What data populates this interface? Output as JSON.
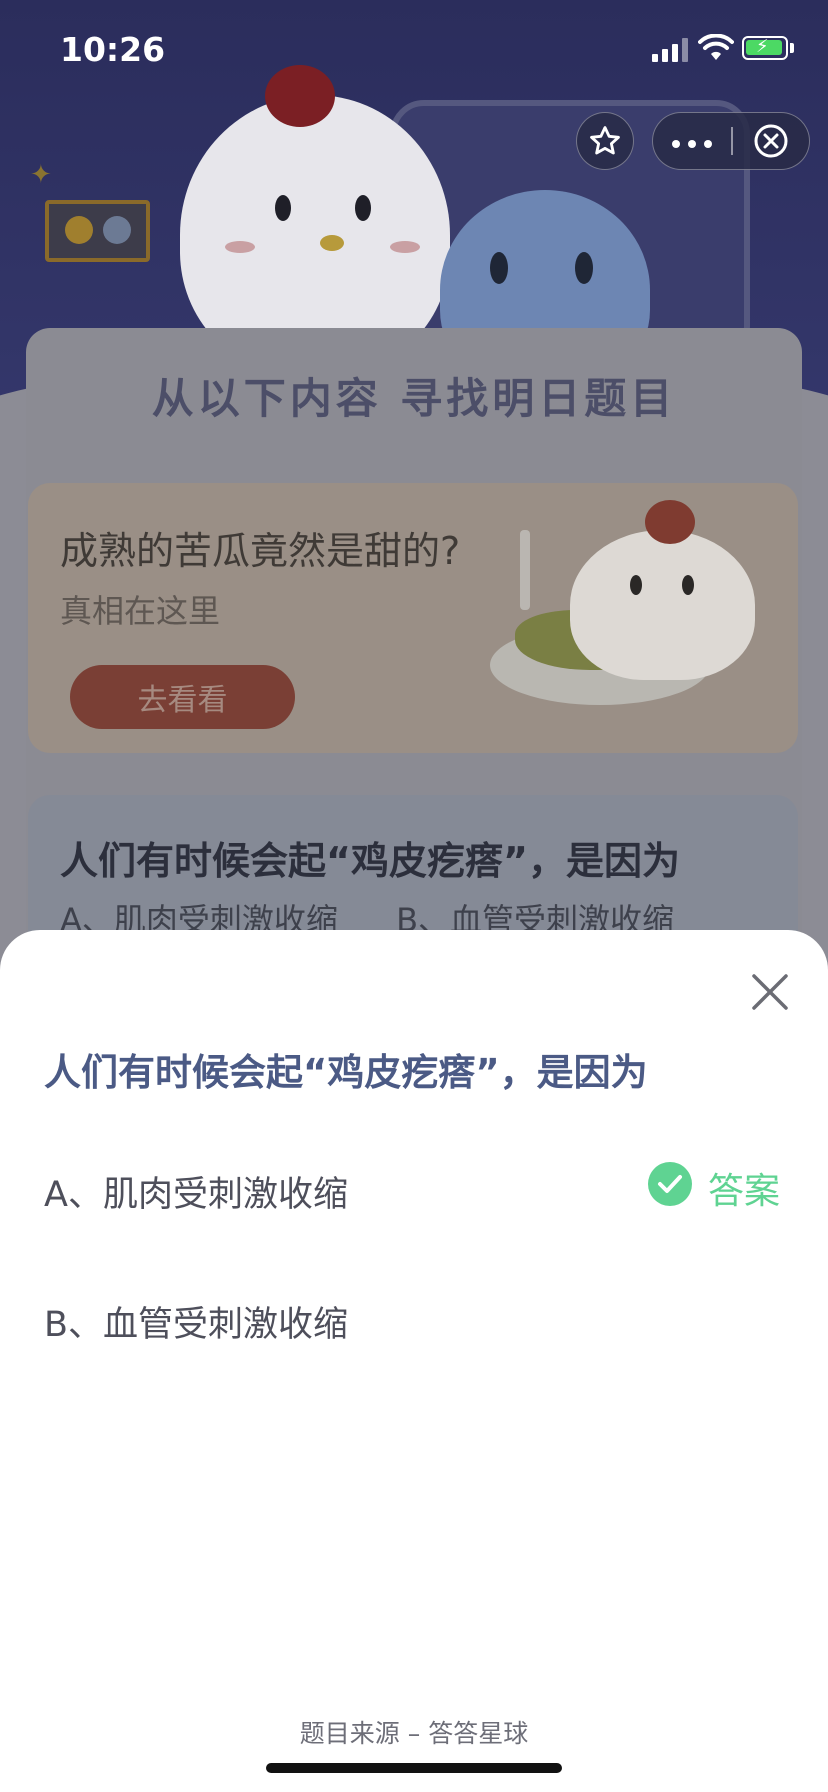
{
  "status_bar": {
    "time": "10:26",
    "icons": [
      "cellular-signal-icon",
      "wifi-icon",
      "battery-charging-icon"
    ]
  },
  "mini_program_bar": {
    "star_icon": "star-icon",
    "more_icon": "more-dots-icon",
    "close_icon": "close-circle-icon"
  },
  "background_page": {
    "section_title": "从以下内容 寻找明日题目",
    "promo": {
      "title": "成熟的苦瓜竟然是甜的?",
      "subtitle": "真相在这里",
      "button_label": "去看看"
    },
    "quiz_preview": {
      "question": "人们有时候会起“鸡皮疙瘩”，是因为",
      "options": [
        "A、肌肉受刺激收缩",
        "B、血管受刺激收缩"
      ]
    }
  },
  "sheet": {
    "close_icon": "close-icon",
    "question": "人们有时候会起“鸡皮疙瘩”，是因为",
    "options": [
      {
        "label": "A、肌肉受刺激收缩",
        "is_answer": true,
        "answer_label": "答案"
      },
      {
        "label": "B、血管受刺激收缩",
        "is_answer": false
      }
    ],
    "source": "题目来源 – 答答星球"
  },
  "colors": {
    "accent_green": "#5fd392",
    "question_blue": "#4b5a85",
    "hero_navy": "#2e3160"
  }
}
